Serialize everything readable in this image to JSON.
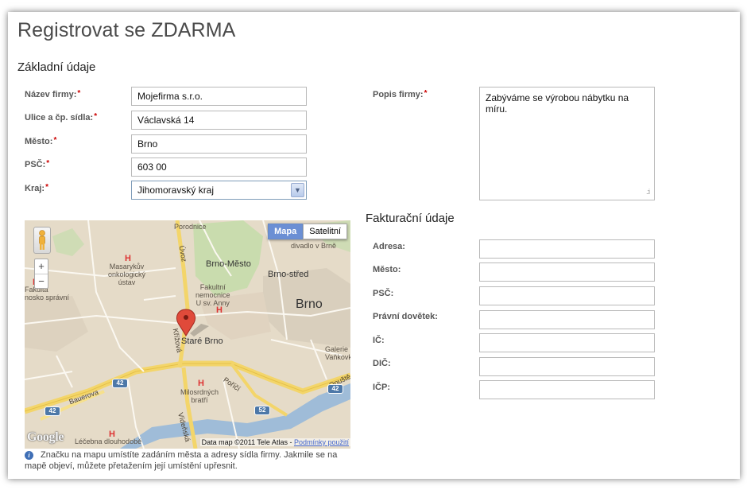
{
  "page": {
    "title": "Registrovat se ZDARMA"
  },
  "basic": {
    "heading": "Základní údaje",
    "fields": [
      {
        "label": "Název firmy:",
        "value": "Mojefirma s.r.o.",
        "required": "*"
      },
      {
        "label": "Ulice a čp. sídla:",
        "value": "Václavská 14",
        "required": "*"
      },
      {
        "label": "Město:",
        "value": "Brno",
        "required": "*"
      },
      {
        "label": "PSČ:",
        "value": "603 00",
        "required": "*"
      },
      {
        "label": "Kraj:",
        "value": "Jihomoravský kraj",
        "required": "*"
      }
    ],
    "description": {
      "label": "Popis firmy:",
      "required": "*",
      "value": "Zabýváme se výrobou nábytku na míru."
    }
  },
  "billing": {
    "heading": "Fakturační údaje",
    "fields": [
      {
        "label": "Adresa:",
        "value": ""
      },
      {
        "label": "Město:",
        "value": ""
      },
      {
        "label": "PSČ:",
        "value": ""
      },
      {
        "label": "Právní dovětek:",
        "value": ""
      },
      {
        "label": "IČ:",
        "value": ""
      },
      {
        "label": "DIČ:",
        "value": ""
      },
      {
        "label": "IČP:",
        "value": ""
      }
    ]
  },
  "map": {
    "type_buttons": {
      "map": "Mapa",
      "satellite": "Satelitní"
    },
    "zoom_in": "+",
    "zoom_out": "−",
    "logo": "Google",
    "attribution": "Data map ©2011 Tele Atlas - ",
    "terms": "Podmínky použití",
    "labels": {
      "porodnice": "Porodnice",
      "brno_mesto": "Brno-Město",
      "brno_stred": "Brno-střed",
      "brno": "Brno",
      "stare_brno": "Staré Brno",
      "masaryk": "Masarykův\nonkologický\nústav",
      "fakultni": "Fakultní\nnemocnice\nU sv. Anny",
      "milosrdnych": "Milosrdných\nbratří",
      "fakulta": "Fakulta\nnosko správní",
      "galerie": "Galerie\nVaňkovka",
      "divadlo": "divadlo v Brně",
      "lecebna": "Léčebna dlouhodobě",
      "uvoz": "Úvoz",
      "kriziva": "Křížová",
      "porici": "Poříčí",
      "bauerova": "Bauerova",
      "videnska": "Vídeňská",
      "opusta": "Opuště"
    },
    "shields": [
      "42",
      "42",
      "42",
      "52"
    ],
    "note": "Značku na mapu umístíte zadáním města a adresy sídla firmy. Jakmile se na mapě objeví, můžete přetažením její umístění upřesnit.",
    "info": "i"
  }
}
